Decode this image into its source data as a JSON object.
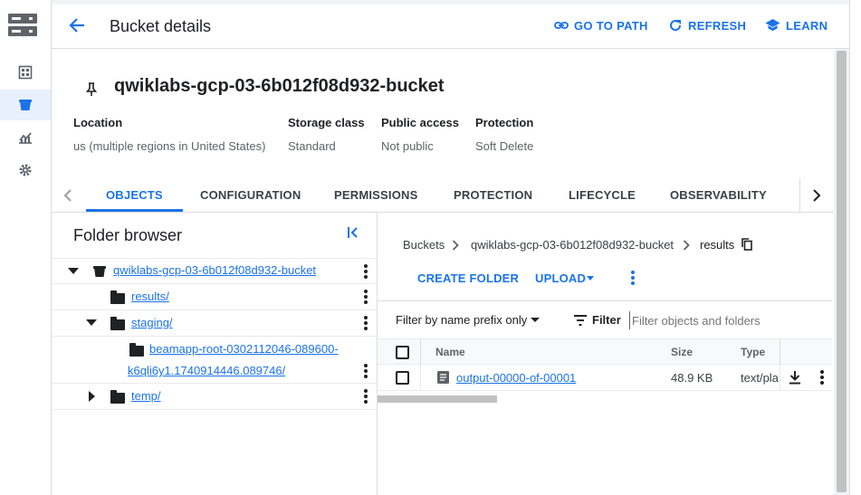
{
  "header": {
    "title": "Bucket details",
    "go_to_path": "GO TO PATH",
    "refresh": "REFRESH",
    "learn": "LEARN"
  },
  "bucket": {
    "name": "qwiklabs-gcp-03-6b012f08d932-bucket",
    "location_label": "Location",
    "location_value": "us (multiple regions in United States)",
    "storage_class_label": "Storage class",
    "storage_class_value": "Standard",
    "public_access_label": "Public access",
    "public_access_value": "Not public",
    "protection_label": "Protection",
    "protection_value": "Soft Delete"
  },
  "tabs": [
    "OBJECTS",
    "CONFIGURATION",
    "PERMISSIONS",
    "PROTECTION",
    "LIFECYCLE",
    "OBSERVABILITY"
  ],
  "folder_browser": {
    "title": "Folder browser",
    "bucket": "qwiklabs-gcp-03-6b012f08d932-bucket",
    "results": "results/",
    "staging": "staging/",
    "beamapp_line1": "beamapp-root-0302112046-089600-",
    "beamapp_line2": "k6qli6y1.1740914446.089746/",
    "temp": "temp/"
  },
  "breadcrumb": {
    "buckets": "Buckets",
    "bucket": "qwiklabs-gcp-03-6b012f08d932-bucket",
    "current": "results"
  },
  "actions": {
    "create_folder": "CREATE FOLDER",
    "upload": "UPLOAD"
  },
  "filter": {
    "prefix_label": "Filter by name prefix only",
    "filter_label": "Filter",
    "placeholder": "Filter objects and folders"
  },
  "table": {
    "headers": {
      "name": "Name",
      "size": "Size",
      "type": "Type"
    },
    "rows": [
      {
        "name": "output-00000-of-00001",
        "size": "48.9 KB",
        "type": "text/pla"
      }
    ]
  },
  "colors": {
    "accent": "#1a73e8",
    "active_nav_bg": "#e8f0fe"
  }
}
